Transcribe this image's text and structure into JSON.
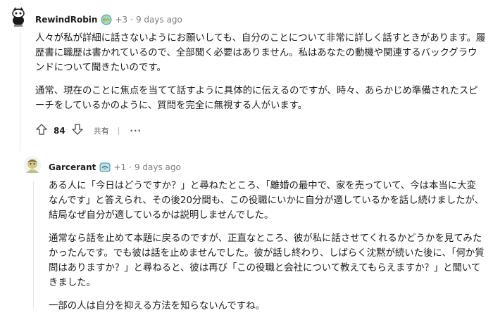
{
  "comment1": {
    "username": "RewindRobin",
    "karma_badge": "+3",
    "time": "9 days ago",
    "separator": "·",
    "paragraphs": [
      "人々が私が詳細に話さないようにお願いしても、自分のことについて非常に詳しく話すときがあります。履歴書に職歴は書かれているので、全部聞く必要はありません。私はあなたの動機や関連するバックグラウンドについて聞きたいのです。",
      "通常、現在のことに焦点を当てて話すように具体的に伝えるのですが、時々、あらかじめ準備されたスピーチをしているかのように、質問を完全に無視する人がいます。"
    ],
    "score": "84",
    "share_label": "共有",
    "divider": "|",
    "more_label": "···"
  },
  "comment2": {
    "username": "Garcerant",
    "karma_badge": "+1",
    "time": "9 days ago",
    "separator": "·",
    "paragraphs": [
      "ある人に「今日はどうですか？」と尋ねたところ、「離婚の最中で、家を売っていて、今は本当に大変なんです」と答えられ、その後20分間も、この役職にいかに自分が適しているかを話し続けましたが、結局なぜ自分が適しているかは説明しませんでした。",
      "通常なら話を止めて本題に戻るのですが、正直なところ、彼が私に話させてくれるかどうかを見てみたかったんです。でも彼は話を止めませんでした。彼が話し終わり、しばらく沈黙が続いた後に、「何か質問はありますか？」と尋ねると、彼は再び「この役職と会社について教えてもらえますか？」と聞いてきました。",
      "一部の人は自分を抑える方法を知らないんですね。"
    ]
  },
  "icons": {
    "upvote": "upvote-arrow-icon",
    "downvote": "downvote-arrow-icon",
    "flair1": "globe-flair-icon",
    "flair2": "badge-flair-icon"
  },
  "colors": {
    "text": "#1c1c1c",
    "meta": "#7c7c7c",
    "thread": "#e4e6e8"
  }
}
